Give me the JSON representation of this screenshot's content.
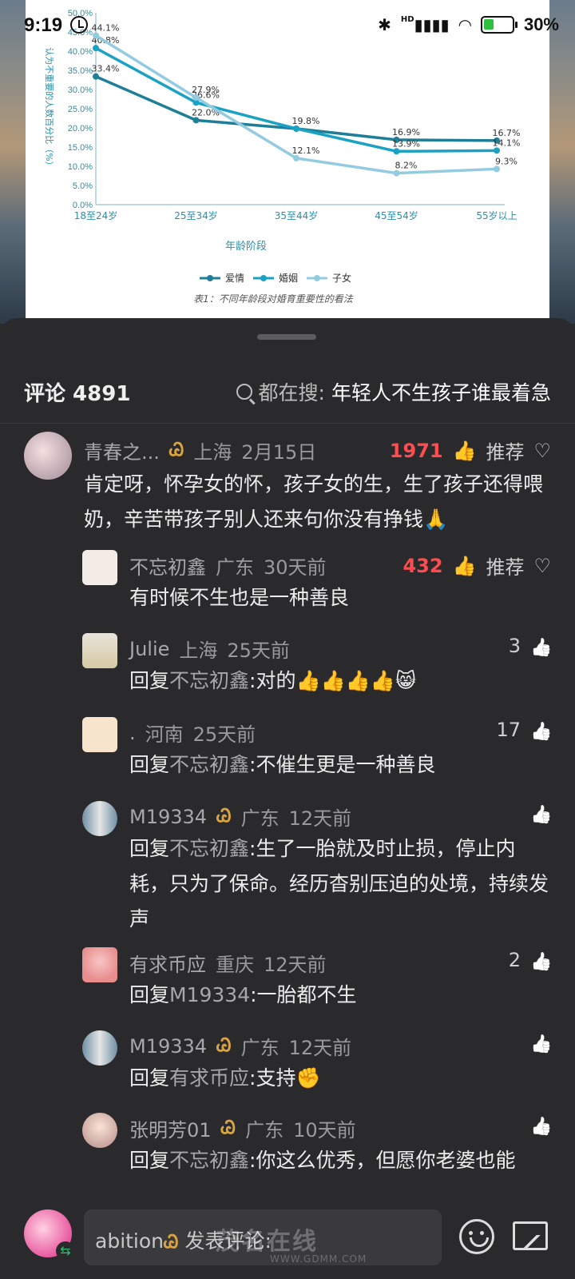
{
  "status_bar": {
    "time": "9:19",
    "network": "HD",
    "battery_percent": "30%"
  },
  "chart_data": {
    "type": "line",
    "categories": [
      "18至24岁",
      "25至34岁",
      "35至44岁",
      "45至54岁",
      "55岁以上"
    ],
    "series": [
      {
        "name": "爱情",
        "values": [
          33.4,
          22.0,
          19.8,
          16.9,
          16.7
        ],
        "labels": [
          "33.4%",
          "22.0%",
          "19.8%",
          "16.9%",
          "16.7%"
        ],
        "color": "#1e7f97"
      },
      {
        "name": "婚姻",
        "values": [
          40.8,
          26.6,
          19.8,
          13.9,
          14.1
        ],
        "labels": [
          "40.8%",
          "26.6%",
          "",
          "13.9%",
          "14.1%"
        ],
        "color": "#1aa2c4"
      },
      {
        "name": "子女",
        "values": [
          44.1,
          27.9,
          12.1,
          8.2,
          9.3
        ],
        "labels": [
          "44.1%",
          "27.9%",
          "12.1%",
          "8.2%",
          "9.3%"
        ],
        "color": "#93cce0"
      }
    ],
    "y_ticks": [
      "0.0%",
      "5.0%",
      "10.0%",
      "15.0%",
      "20.0%",
      "25.0%",
      "30.0%",
      "35.0%",
      "40.0%",
      "45.0%",
      "50.0%"
    ],
    "ylim": [
      0,
      50
    ],
    "xlabel": "年龄阶段",
    "ylabel": "认为不重要的人数百分比（%）",
    "caption": "表1：不同年龄段对婚育重要性的看法",
    "legend_position": "bottom"
  },
  "header": {
    "comment_label": "评论 4891",
    "trend_label": "都在搜:",
    "trend_topic": "年轻人不生孩子谁最着急"
  },
  "comments": [
    {
      "user": "青春之...",
      "location": "上海",
      "time": "2月15日",
      "likes": "1971",
      "recommend": "推荐",
      "text": "肯定呀，怀孕女的怀，孩子女的生，生了孩子还得喂奶，辛苦带孩子别人还来句你没有挣钱🙏"
    },
    {
      "user": "不忘初鑫",
      "location": "广东",
      "time": "30天前",
      "likes": "432",
      "recommend": "推荐",
      "text": "有时候不生也是一种善良"
    },
    {
      "user": "Julie",
      "location": "上海",
      "time": "25天前",
      "likes": "3",
      "reply_prefix": "回复",
      "reply_to": "不忘初鑫",
      "text": ":对的👍👍👍👍😸"
    },
    {
      "user": ".",
      "location": "河南",
      "time": "25天前",
      "likes": "17",
      "reply_prefix": "回复",
      "reply_to": "不忘初鑫",
      "text": ":不催生更是一种善良"
    },
    {
      "user": "M19334",
      "location": "广东",
      "time": "12天前",
      "likes": "",
      "reply_prefix": "回复",
      "reply_to": "不忘初鑫",
      "text": ":生了一胎就及时止损，停止内耗，只为了保命。经历杳别压迫的处境，持续发声"
    },
    {
      "user": "有求币应",
      "location": "重庆",
      "time": "12天前",
      "likes": "2",
      "reply_prefix": "回复",
      "reply_to": "M19334",
      "text": ":一胎都不生"
    },
    {
      "user": "M19334",
      "location": "广东",
      "time": "12天前",
      "likes": "",
      "reply_prefix": "回复",
      "reply_to": "有求币应",
      "text": ":支持✊"
    },
    {
      "user": "张明芳01",
      "location": "广东",
      "time": "10天前",
      "likes": "",
      "reply_prefix": "回复",
      "reply_to": "不忘初鑫",
      "text": ":你这么优秀，但愿你老婆也能"
    }
  ],
  "bottom_bar": {
    "username": "abition",
    "placeholder": "发表评论:"
  },
  "watermark": {
    "main": "茂名在线",
    "sub": "WWW.GDMM.COM"
  }
}
